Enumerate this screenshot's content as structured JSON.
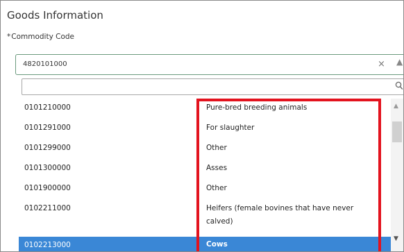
{
  "section": {
    "title": "Goods Information"
  },
  "commodity_field": {
    "required_marker": "*",
    "label": "Commodity Code",
    "value": "4820101000",
    "clear_glyph": "×",
    "caret_glyph": "▲"
  },
  "search": {
    "placeholder": "",
    "icon": "search-icon"
  },
  "options": [
    {
      "code": "0101210000",
      "description": "Pure-bred breeding animals"
    },
    {
      "code": "0101291000",
      "description": "For slaughter"
    },
    {
      "code": "0101299000",
      "description": "Other"
    },
    {
      "code": "0101300000",
      "description": "Asses"
    },
    {
      "code": "0101900000",
      "description": "Other"
    },
    {
      "code": "0102211000",
      "description": "Heifers (female bovines that have never calved)"
    },
    {
      "code": "0102213000",
      "description": "Cows"
    }
  ],
  "scrollbar": {
    "up_glyph": "▲",
    "down_glyph": "▼"
  },
  "colors": {
    "selected_row": "#3a87d6",
    "highlight_border": "#e3131e",
    "field_border": "#6a9a7d"
  }
}
